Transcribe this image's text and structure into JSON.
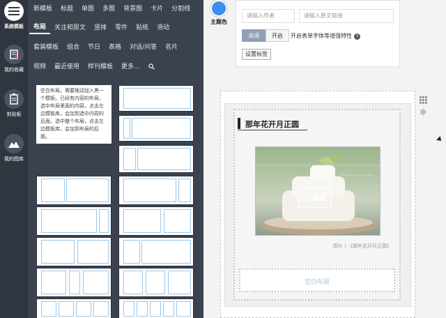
{
  "rail": {
    "items": [
      {
        "label": "系统模板",
        "icon": "menu-icon"
      },
      {
        "label": "我的收藏",
        "icon": "book-icon"
      },
      {
        "label": "剪贴板",
        "icon": "clipboard-icon"
      },
      {
        "label": "我的图库",
        "icon": "mountain-icon"
      }
    ]
  },
  "menu": {
    "row1": [
      "新模板",
      "标题",
      "单图",
      "多图",
      "背景图",
      "卡片",
      "分割线"
    ],
    "row2": [
      "布局",
      "关注和原文",
      "竖排",
      "零件",
      "贴纸",
      "滑动"
    ],
    "row3": [
      "套装模板",
      "组合",
      "节日",
      "表格",
      "对话/问答",
      "名片"
    ],
    "row4": [
      "视频",
      "最近使用",
      "样刊模板",
      "更多..."
    ]
  },
  "theme": {
    "label": "主题色",
    "color": "#3d8ef0"
  },
  "blank_layout_desc": "空白布局，需要拖动加入黑一个模板。已经有内容的布局，选中布局里面的内容，点击左边模板库，会加到选中内容的后面。选中整个布局，点击左边模板库，会加到布局的后面。",
  "settings": {
    "author_placeholder": "请输入作者",
    "link_placeholder": "请输入原文链接",
    "toggle_off": "关闭",
    "toggle_on": "开启",
    "toggle_label": "开启表单字体等增强特性",
    "help": "?",
    "set_tags_button": "设置标签"
  },
  "editor": {
    "title": "那年花开月正圆",
    "image_label": "小方套装",
    "caption": "图片丨《那年花开月正圆》",
    "blank_layout": "空白布局"
  },
  "colors": {
    "rail_bg": "#2f3640",
    "panel_bg": "#3a424d",
    "layout_cell_border": "#9bc6e8",
    "accent": "#3d8ef0"
  }
}
